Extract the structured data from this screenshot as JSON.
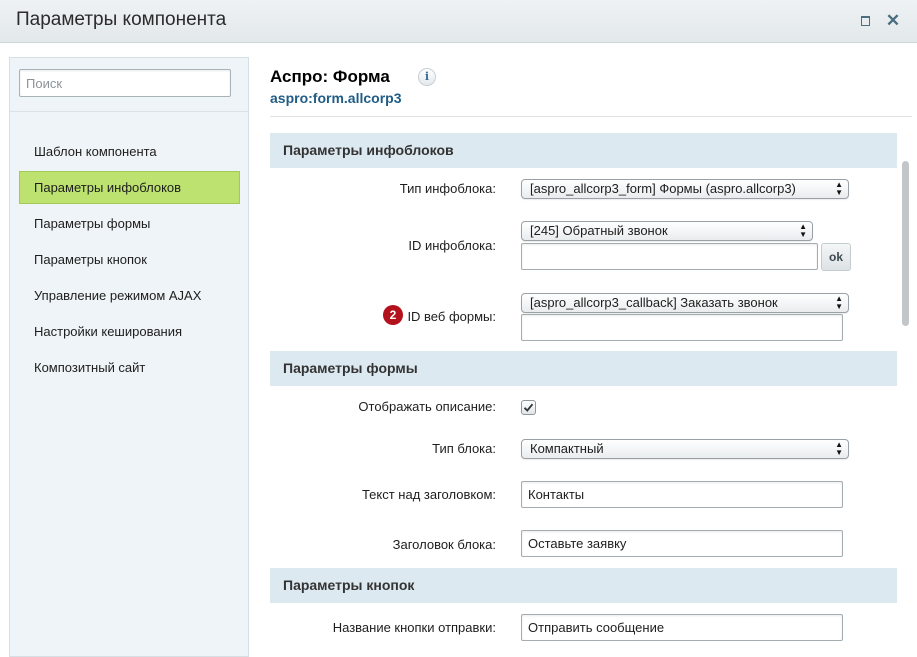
{
  "window": {
    "title": "Параметры компонента",
    "maximize_icon": "maximize-icon",
    "close_icon": "close-icon",
    "close_glyph": "✕"
  },
  "sidebar": {
    "search_placeholder": "Поиск",
    "items": [
      {
        "label": "Шаблон компонента",
        "active": false
      },
      {
        "label": "Параметры инфоблоков",
        "active": true
      },
      {
        "label": "Параметры формы",
        "active": false
      },
      {
        "label": "Параметры кнопок",
        "active": false
      },
      {
        "label": "Управление режимом AJAX",
        "active": false
      },
      {
        "label": "Настройки кеширования",
        "active": false
      },
      {
        "label": "Композитный сайт",
        "active": false
      }
    ]
  },
  "component": {
    "title": "Аспро: Форма",
    "info_glyph": "i",
    "code": "aspro:form.allcorp3"
  },
  "sections": {
    "iblock": {
      "header": "Параметры инфоблоков",
      "iblock_type_label": "Тип инфоблока:",
      "iblock_type_value": "[aspro_allcorp3_form] Формы (aspro.allcorp3)",
      "iblock_id_label": "ID инфоблока:",
      "iblock_id_value": "[245] Обратный звонок",
      "iblock_id_text": "",
      "ok_label": "ok",
      "webform_label": "ID веб формы:",
      "webform_badge": "2",
      "webform_value": "[aspro_allcorp3_callback] Заказать звонок",
      "webform_text": ""
    },
    "form": {
      "header": "Параметры формы",
      "show_desc_label": "Отображать описание:",
      "show_desc_checked": true,
      "block_type_label": "Тип блока:",
      "block_type_value": "Компактный",
      "text_above_label": "Текст над заголовком:",
      "text_above_value": "Контакты",
      "block_title_label": "Заголовок блока:",
      "block_title_value": "Оставьте заявку"
    },
    "buttons": {
      "header": "Параметры кнопок",
      "send_label": "Название кнопки отправки:",
      "send_value": "Отправить сообщение"
    }
  },
  "colors": {
    "active_item": "#bde26f",
    "section_header": "#dde9f1",
    "code_link": "#205d86",
    "badge": "#b3121c"
  }
}
